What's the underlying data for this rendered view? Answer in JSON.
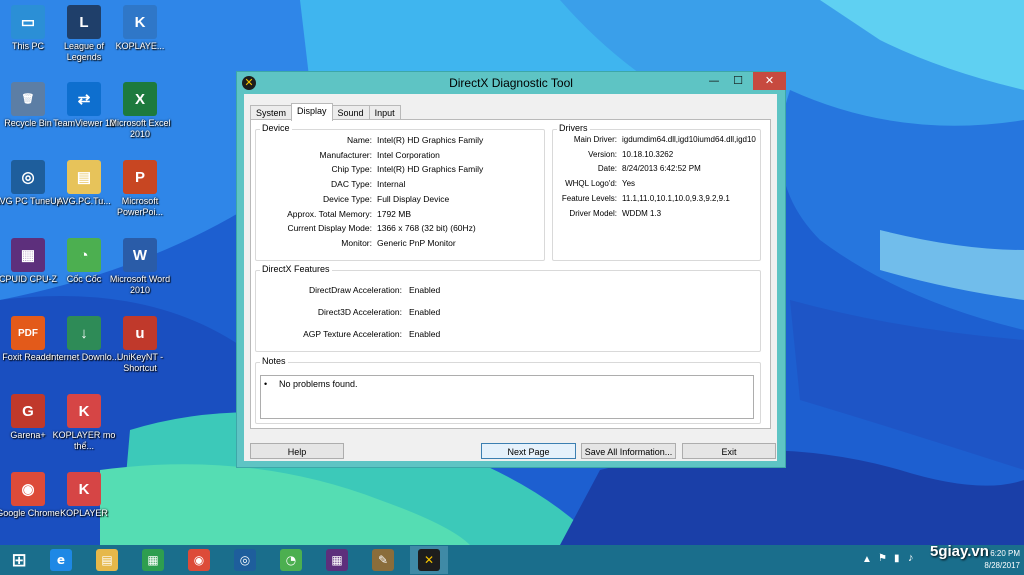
{
  "desktop": {
    "icons": [
      {
        "label": "This PC"
      },
      {
        "label": "League of Legends"
      },
      {
        "label": "KOPLAYE..."
      },
      {
        "label": "Recycle Bin"
      },
      {
        "label": "TeamViewer 12"
      },
      {
        "label": "Microsoft Excel 2010"
      },
      {
        "label": "AVG PC TuneUp"
      },
      {
        "label": "AVG.PC.Tu..."
      },
      {
        "label": "Microsoft PowerPoi..."
      },
      {
        "label": "CPUID CPU-Z"
      },
      {
        "label": "Cốc Cốc"
      },
      {
        "label": "Microsoft Word 2010"
      },
      {
        "label": "Foxit Reader"
      },
      {
        "label": "Internet Downlo..."
      },
      {
        "label": "UniKeyNT - Shortcut"
      },
      {
        "label": "Garena+"
      },
      {
        "label": "KOPLAYER mo thể..."
      },
      {
        "label": "Google Chrome"
      },
      {
        "label": "KOPLAYER"
      }
    ]
  },
  "window": {
    "title": "DirectX Diagnostic Tool",
    "close_glyph": "✕",
    "min_glyph": "—",
    "max_glyph": "☐",
    "tabs": [
      {
        "label": "System",
        "active": false
      },
      {
        "label": "Display",
        "active": true
      },
      {
        "label": "Sound",
        "active": false
      },
      {
        "label": "Input",
        "active": false
      }
    ],
    "device": {
      "title": "Device",
      "rows": [
        {
          "key": "Name:",
          "value": "Intel(R) HD Graphics Family"
        },
        {
          "key": "Manufacturer:",
          "value": "Intel Corporation"
        },
        {
          "key": "Chip Type:",
          "value": "Intel(R) HD Graphics Family"
        },
        {
          "key": "DAC Type:",
          "value": "Internal"
        },
        {
          "key": "Device Type:",
          "value": "Full Display Device"
        },
        {
          "key": "Approx. Total Memory:",
          "value": "1792 MB"
        },
        {
          "key": "Current Display Mode:",
          "value": "1366 x 768 (32 bit) (60Hz)"
        },
        {
          "key": "Monitor:",
          "value": "Generic PnP Monitor"
        }
      ]
    },
    "drivers": {
      "title": "Drivers",
      "rows": [
        {
          "key": "Main Driver:",
          "value": "igdumdim64.dll,igd10iumd64.dll,igd10"
        },
        {
          "key": "Version:",
          "value": "10.18.10.3262"
        },
        {
          "key": "Date:",
          "value": "8/24/2013 6:42:52 PM"
        },
        {
          "key": "WHQL Logo'd:",
          "value": "Yes"
        },
        {
          "key": "Feature Levels:",
          "value": "11.1,11.0,10.1,10.0,9.3,9.2,9.1"
        },
        {
          "key": "Driver Model:",
          "value": "WDDM 1.3"
        }
      ]
    },
    "features": {
      "title": "DirectX Features",
      "rows": [
        {
          "key": "DirectDraw Acceleration:",
          "value": "Enabled"
        },
        {
          "key": "Direct3D Acceleration:",
          "value": "Enabled"
        },
        {
          "key": "AGP Texture Acceleration:",
          "value": "Enabled"
        }
      ]
    },
    "notes": {
      "title": "Notes",
      "items": [
        "No problems found."
      ]
    },
    "buttons": {
      "help": "Help",
      "next_page": "Next Page",
      "save_all": "Save All Information...",
      "exit": "Exit"
    }
  },
  "taskbar": {
    "clock_time": "6:20 PM",
    "clock_date": "8/28/2017"
  },
  "watermark": "5giay.vn"
}
